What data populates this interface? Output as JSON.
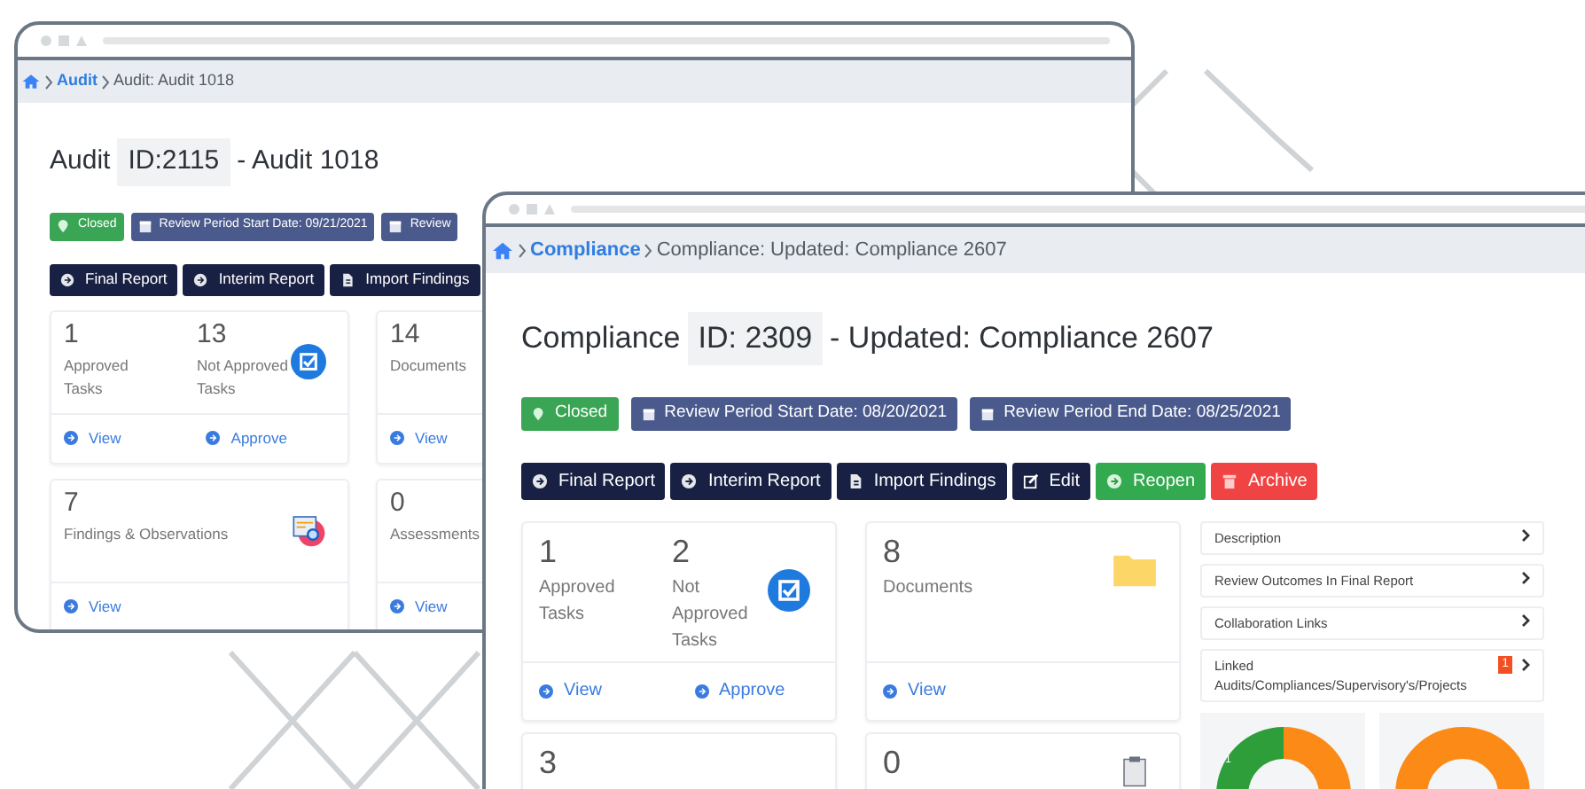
{
  "back_window": {
    "breadcrumb": [
      {
        "label": "Audit",
        "kind": "link"
      },
      {
        "label": "Audit: Audit 1018",
        "kind": "current"
      }
    ],
    "title": {
      "prefix": "Audit",
      "id": "ID:2115",
      "suffix": "- Audit 1018"
    },
    "badges": [
      {
        "label": "Closed",
        "kind": "status"
      },
      {
        "label": "Review Period Start Date: 09/21/2021",
        "kind": "date"
      },
      {
        "label": "Review",
        "kind": "date"
      }
    ],
    "buttons": [
      {
        "label": "Final Report",
        "kind": "report"
      },
      {
        "label": "Interim Report",
        "kind": "report"
      },
      {
        "label": "Import Findings",
        "kind": "import"
      }
    ],
    "cards": [
      {
        "kind": "tasks",
        "stats": [
          {
            "value": "1",
            "label": "Approved Tasks"
          },
          {
            "value": "13",
            "label": "Not Approved Tasks"
          }
        ],
        "actions": [
          "View",
          "Approve"
        ]
      },
      {
        "kind": "plain",
        "stats": [
          {
            "value": "14",
            "label": "Documents"
          }
        ],
        "actions": [
          "View"
        ]
      },
      {
        "kind": "findings",
        "stats": [
          {
            "value": "7",
            "label": "Findings & Observations"
          }
        ],
        "actions": [
          "View"
        ]
      },
      {
        "kind": "plain",
        "stats": [
          {
            "value": "0",
            "label": "Assessments"
          }
        ],
        "actions": [
          "View"
        ]
      }
    ]
  },
  "front_window": {
    "breadcrumb": [
      {
        "label": "Compliance",
        "kind": "link"
      },
      {
        "label": "Compliance: Updated: Compliance 2607",
        "kind": "current"
      }
    ],
    "title": {
      "prefix": "Compliance",
      "id": "ID: 2309",
      "suffix": "- Updated: Compliance 2607"
    },
    "badges": [
      {
        "label": "Closed",
        "kind": "status"
      },
      {
        "label": "Review Period Start Date: 08/20/2021",
        "kind": "date"
      },
      {
        "label": "Review Period End Date: 08/25/2021",
        "kind": "date"
      }
    ],
    "buttons": [
      {
        "label": "Final Report",
        "kind": "report"
      },
      {
        "label": "Interim Report",
        "kind": "report"
      },
      {
        "label": "Import Findings",
        "kind": "import"
      },
      {
        "label": "Edit",
        "kind": "edit"
      },
      {
        "label": "Reopen",
        "kind": "reopen"
      },
      {
        "label": "Archive",
        "kind": "archive"
      }
    ],
    "cards": [
      {
        "kind": "tasks",
        "stats": [
          {
            "value": "1",
            "label": "Approved Tasks"
          },
          {
            "value": "2",
            "label": "Not Approved Tasks"
          }
        ],
        "actions": [
          "View",
          "Approve"
        ]
      },
      {
        "kind": "documents",
        "stats": [
          {
            "value": "8",
            "label": "Documents"
          }
        ],
        "actions": [
          "View"
        ]
      },
      {
        "kind": "plain",
        "stats": [
          {
            "value": "3"
          }
        ]
      },
      {
        "kind": "checklist",
        "stats": [
          {
            "value": "0"
          }
        ]
      }
    ],
    "panel_items": [
      {
        "label": "Description"
      },
      {
        "label": "Review Outcomes In Final Report"
      },
      {
        "label": "Collaboration Links"
      },
      {
        "label": "Linked Audits/Compliances/Supervisory's/Projects",
        "count": "1"
      }
    ],
    "donut_label": "1"
  }
}
